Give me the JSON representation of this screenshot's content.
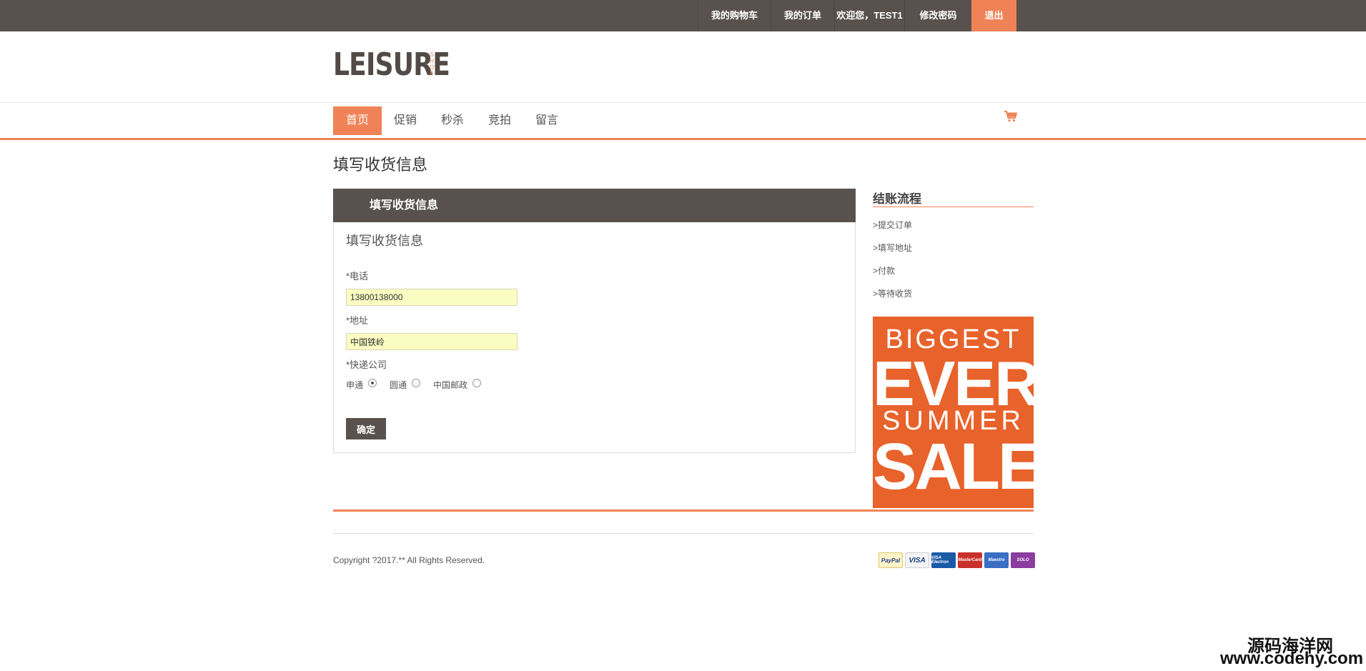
{
  "topnav": {
    "cart": "我的购物车",
    "orders": "我的订单",
    "welcome": "欢迎您，TEST1",
    "change_password": "修改密码",
    "logout": "退出"
  },
  "logo": {
    "main": "LEISURE",
    "sub": "SHOP"
  },
  "mainnav": {
    "items": [
      {
        "label": "首页"
      },
      {
        "label": "促销"
      },
      {
        "label": "秒杀"
      },
      {
        "label": "竞拍"
      },
      {
        "label": "留言"
      }
    ]
  },
  "icons": {
    "cart": "cart-icon",
    "accent_color": "#ef8357",
    "dark_color": "#58514d"
  },
  "page": {
    "title": "填写收货信息"
  },
  "form": {
    "header": "填写收货信息",
    "title": "填写收货信息",
    "phone_label": "*电话",
    "phone_value": "13800138000",
    "address_label": "*地址",
    "address_value": "中国铁岭",
    "courier_label": "*快递公司",
    "courier_options": [
      {
        "label": "申通",
        "selected": true
      },
      {
        "label": "圆通",
        "selected": false
      },
      {
        "label": "中国邮政",
        "selected": false
      }
    ],
    "submit": "确定"
  },
  "sidebar": {
    "title": "结账流程",
    "steps": [
      ">提交订单",
      ">填写地址",
      ">付款",
      ">等待收货"
    ],
    "promo": {
      "line1": "BIGGEST",
      "line2": "EVER",
      "line3": "SUMMER",
      "line4": "SALE"
    }
  },
  "footer": {
    "copyright": "Copyright ?2017.** All Rights Reserved.",
    "payments": [
      "PayPal",
      "VISA",
      "VISA Electron",
      "MasterCard",
      "Maestro",
      "SOLO"
    ]
  },
  "watermark": {
    "line1": "源码海洋网",
    "line2": "www.codehy.com"
  }
}
